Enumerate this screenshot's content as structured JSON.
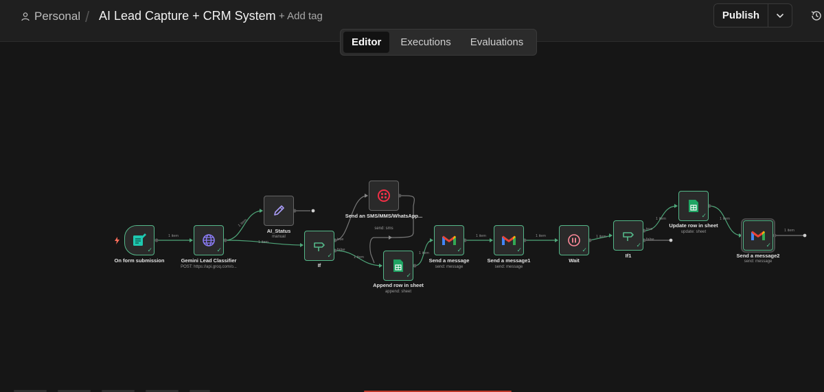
{
  "header": {
    "workspace": "Personal",
    "separator": "/",
    "workflow_title": "AI Lead Capture + CRM System",
    "add_tag": "+ Add tag",
    "publish": "Publish"
  },
  "tabs": [
    {
      "label": "Editor",
      "active": true
    },
    {
      "label": "Executions",
      "active": false
    },
    {
      "label": "Evaluations",
      "active": false
    }
  ],
  "colors": {
    "success": "#55b98a",
    "gmail_red": "#ea4335",
    "sheets_green": "#1fa463",
    "twilio_red": "#f22f46",
    "webhook_teal": "#1ec8b0",
    "globe_purple": "#8b7cf6"
  },
  "nodes": [
    {
      "id": "form",
      "label": "On form submission",
      "sub": "",
      "icon": "form-trigger-icon"
    },
    {
      "id": "gemini",
      "label": "Gemini Lead Classifier",
      "sub": "POST: https://api.groq.com/o...",
      "icon": "globe-icon"
    },
    {
      "id": "aistatus",
      "label": "AI_Status",
      "sub": "manual",
      "icon": "pencil-icon"
    },
    {
      "id": "if",
      "label": "If",
      "sub": "",
      "icon": "if-signpost-icon"
    },
    {
      "id": "twilio",
      "label": "Send an SMS/MMS/WhatsApp...",
      "sub": "send: sms",
      "icon": "twilio-icon"
    },
    {
      "id": "append",
      "label": "Append row in sheet",
      "sub": "append: sheet",
      "icon": "google-sheets-icon"
    },
    {
      "id": "msg",
      "label": "Send a message",
      "sub": "send: message",
      "icon": "gmail-icon"
    },
    {
      "id": "msg1",
      "label": "Send a message1",
      "sub": "send: message",
      "icon": "gmail-icon"
    },
    {
      "id": "wait",
      "label": "Wait",
      "sub": "",
      "icon": "pause-icon"
    },
    {
      "id": "if1",
      "label": "If1",
      "sub": "",
      "icon": "if-signpost-icon"
    },
    {
      "id": "update",
      "label": "Update row in sheet",
      "sub": "update: sheet",
      "icon": "google-sheets-icon"
    },
    {
      "id": "msg2",
      "label": "Send a message2",
      "sub": "send: message",
      "icon": "gmail-icon"
    }
  ],
  "edge_labels": {
    "one_item": "1 item",
    "true": "true",
    "false": "false"
  }
}
